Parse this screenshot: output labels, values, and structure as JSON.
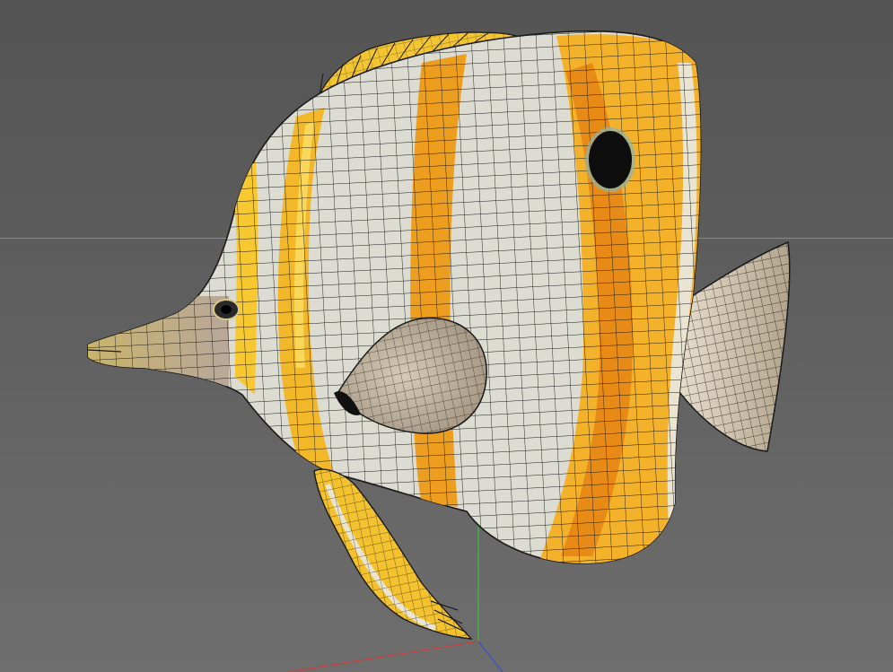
{
  "viewport": {
    "type": "3d-perspective-viewport",
    "display_mode": "textured-wireframe"
  },
  "model": {
    "subject": "butterflyfish",
    "colors": {
      "body_white": "#dcdcd2",
      "stripe_orange": "#f0a020",
      "stripe_yellow": "#f7c830",
      "fin_grey": "#b9ab95",
      "wire": "#1a1a1a",
      "eyespot": "#0e0e0e"
    }
  },
  "axes": {
    "x_color": "#c8413f",
    "y_color": "#3fb84a",
    "z_color": "#3a4fc8"
  },
  "background": {
    "color": "#5f5f5f",
    "horizon_color": "#8a8a8a"
  }
}
